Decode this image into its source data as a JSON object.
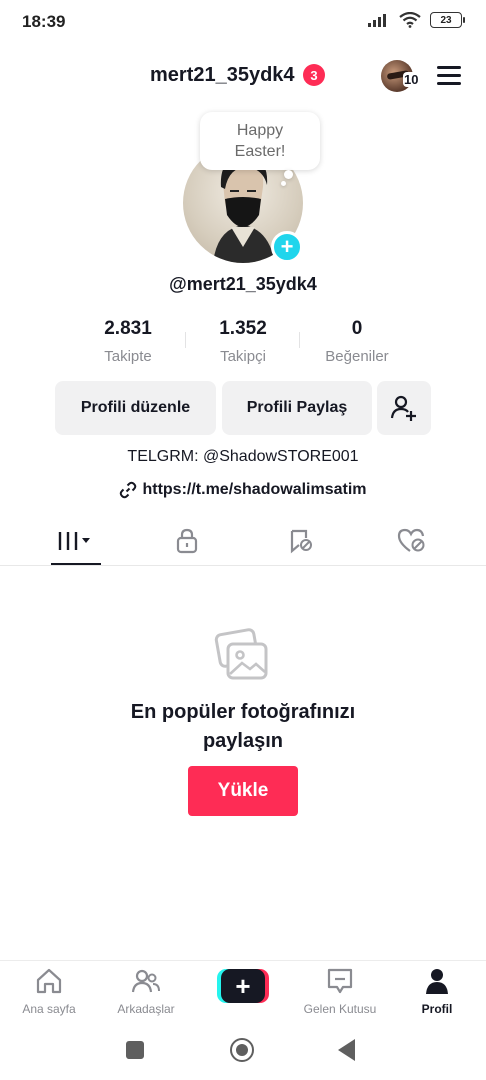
{
  "status_bar": {
    "time": "18:39",
    "battery": "23"
  },
  "header": {
    "username": "mert21_35ydk4",
    "notification_count": "3",
    "account_count": "10"
  },
  "note": {
    "line1": "Happy",
    "line2": "Easter!"
  },
  "profile": {
    "handle": "@mert21_35ydk4",
    "stats": [
      {
        "value": "2.831",
        "label": "Takipte"
      },
      {
        "value": "1.352",
        "label": "Takipçi"
      },
      {
        "value": "0",
        "label": "Beğeniler"
      }
    ],
    "edit_button": "Profili düzenle",
    "share_button": "Profili Paylaş",
    "bio": "TELGRM: @ShadowSTORE001",
    "link": "https://t.me/shadowalimsatim"
  },
  "tabs": [
    {
      "icon": "grid-icon",
      "active": true
    },
    {
      "icon": "lock-icon",
      "active": false
    },
    {
      "icon": "bookmark-icon",
      "active": false
    },
    {
      "icon": "liked-icon",
      "active": false
    }
  ],
  "empty_state": {
    "title": "En popüler fotoğrafınızı paylaşın",
    "button": "Yükle"
  },
  "bottom_nav": [
    {
      "label": "Ana sayfa",
      "icon": "home-icon"
    },
    {
      "label": "Arkadaşlar",
      "icon": "friends-icon"
    },
    {
      "label": "",
      "icon": "create-icon"
    },
    {
      "label": "Gelen Kutusu",
      "icon": "inbox-icon"
    },
    {
      "label": "Profil",
      "icon": "profile-icon"
    }
  ],
  "colors": {
    "accent": "#fe2c55",
    "cyan": "#20d5ec",
    "text": "#161823",
    "muted": "#8a8b91"
  }
}
